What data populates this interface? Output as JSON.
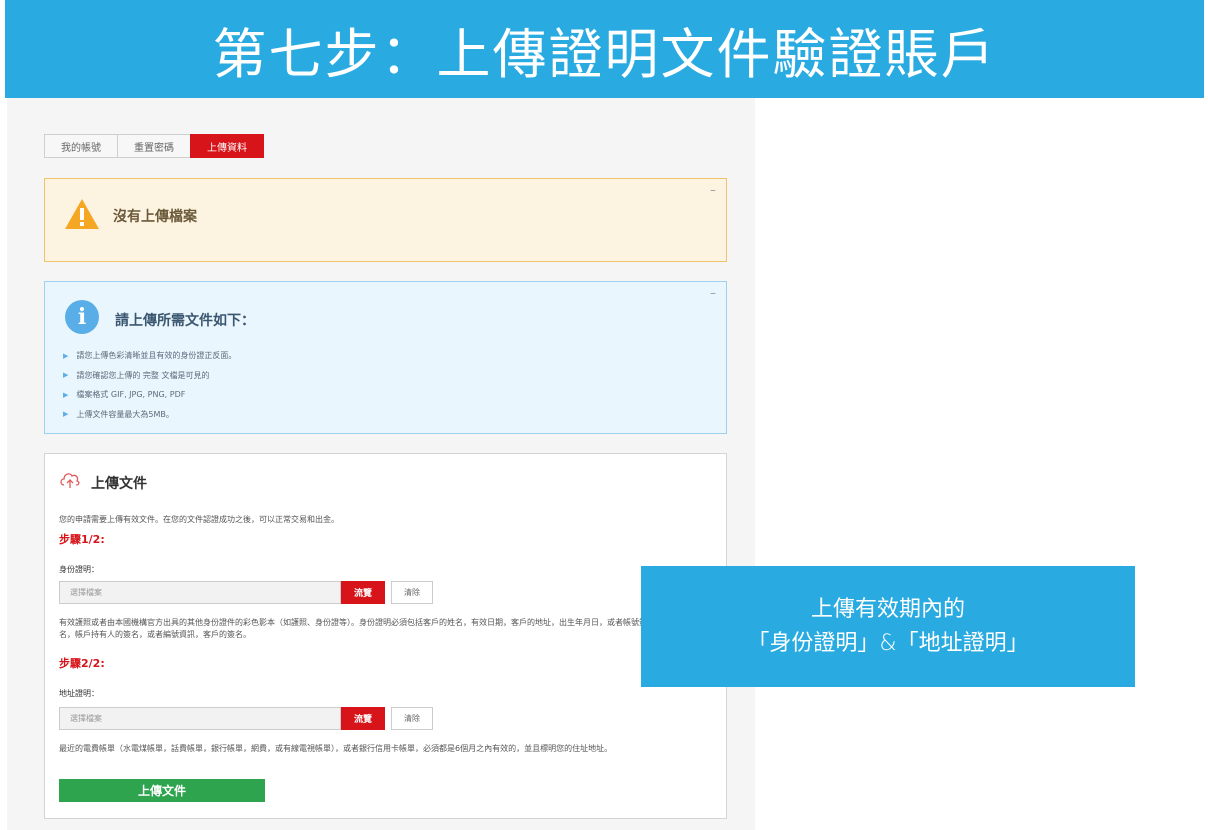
{
  "banner": {
    "title": "第七步：上傳證明文件驗證賬戶"
  },
  "tabs": [
    {
      "label": "我的帳號",
      "active": false
    },
    {
      "label": "重置密碼",
      "active": false
    },
    {
      "label": "上傳資料",
      "active": true
    }
  ],
  "warning": {
    "text": "沒有上傳檔案",
    "collapse": "–"
  },
  "info": {
    "title": "請上傳所需文件如下：",
    "collapse": "–",
    "items": [
      "請您上傳色彩清晰並且有效的身份證正反面。",
      "請您確認您上傳的 完整 文檔是可見的",
      "檔案格式 GIF, JPG, PNG, PDF",
      "上傳文件容量最大為5MB。"
    ]
  },
  "upload": {
    "title": "上傳文件",
    "description": "您的申請需要上傳有效文件。在您的文件認證成功之後，可以正常交易和出金。",
    "step1": "步驟1/2:",
    "id_label": "身份證明：",
    "file_placeholder": "選擇檔案",
    "browse_label": "流覽",
    "clear_label": "清除",
    "id_note": "有效護照或者由本國機構官方出具的其他身份證件的彩色影本（如護照、身份證等）。身份證明必須包括客戶的姓名，有效日期，客戶的地址，出生年月日，或者帳號簽名，帳戶持有人的簽名，或者編號資訊，客戶的簽名。",
    "step2": "步驟2/2:",
    "address_label": "地址證明：",
    "address_note": "最近的電費帳單（水電煤帳單，話費帳單，銀行帳單，網費，或有線電視帳單），或者銀行信用卡帳單，必須都是6個月之內有效的，並且標明您的住址地址。",
    "submit_label": "上傳文件"
  },
  "callout": {
    "line1": "上傳有效期內的",
    "line2": "「身份證明」&「地址證明」"
  },
  "colors": {
    "brand_blue": "#29abe2",
    "accent_red": "#d7141a",
    "submit_green": "#2ea44f"
  }
}
